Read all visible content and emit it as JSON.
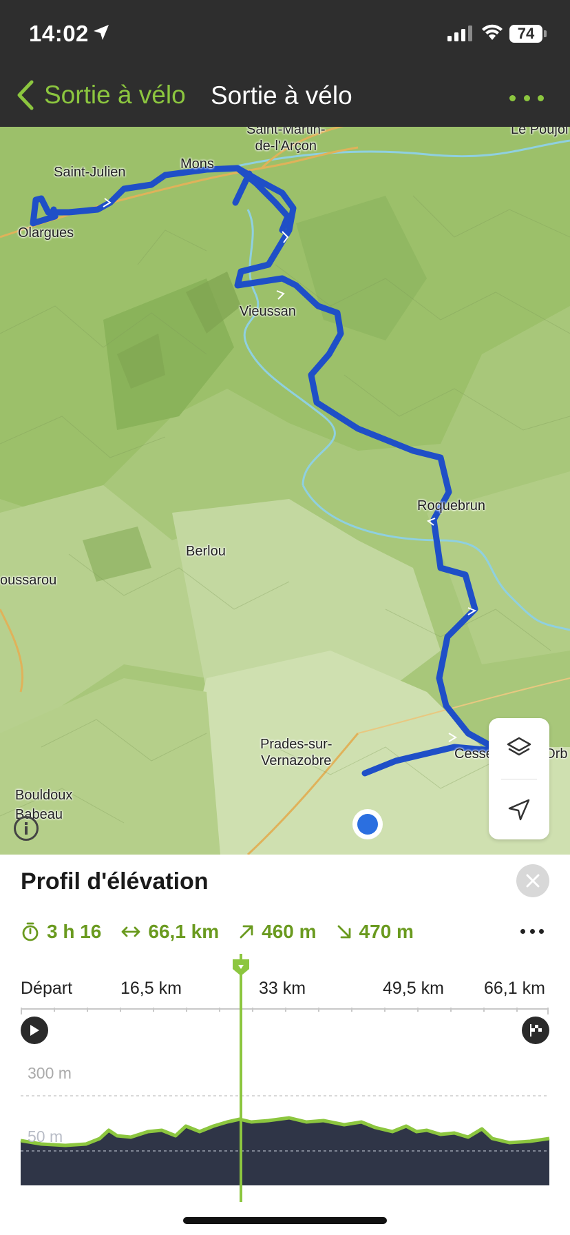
{
  "status_bar": {
    "time": "14:02",
    "battery": "74"
  },
  "nav": {
    "back_label": "Sortie à vélo",
    "title": "Sortie à vélo"
  },
  "map": {
    "places": [
      {
        "id": "saint-martin",
        "text": "Saint-Martin-\nde-l'Arçon"
      },
      {
        "id": "le-poujol",
        "text": "Le Poujol"
      },
      {
        "id": "saint-julien",
        "text": "Saint-Julien"
      },
      {
        "id": "mons",
        "text": "Mons"
      },
      {
        "id": "olargues",
        "text": "Olargues"
      },
      {
        "id": "vieussan",
        "text": "Vieussan"
      },
      {
        "id": "roquebrun",
        "text": "Roquebrun"
      },
      {
        "id": "berlou",
        "text": "Berlou"
      },
      {
        "id": "boussarou",
        "text": "oussarou"
      },
      {
        "id": "prades",
        "text": "Prades-sur-\nVernazobre"
      },
      {
        "id": "cessenon",
        "text": "Cessenon-sur-Orb"
      },
      {
        "id": "bouldoux",
        "text": "Bouldoux"
      },
      {
        "id": "babeau",
        "text": "Babeau"
      }
    ]
  },
  "elevation": {
    "title": "Profil d'élévation",
    "stats": {
      "duration": "3 h 16",
      "distance": "66,1 km",
      "ascent": "460 m",
      "descent": "470 m"
    },
    "distance_axis": [
      "Départ",
      "16,5 km",
      "33 km",
      "49,5 km",
      "66,1 km"
    ],
    "elevation_axis": [
      "300 m",
      "50 m"
    ],
    "colors": {
      "accent": "#8cc63f",
      "accent_text": "#6a9a1f",
      "route": "#1f4fc7",
      "profile_fill": "#2f3547"
    }
  }
}
